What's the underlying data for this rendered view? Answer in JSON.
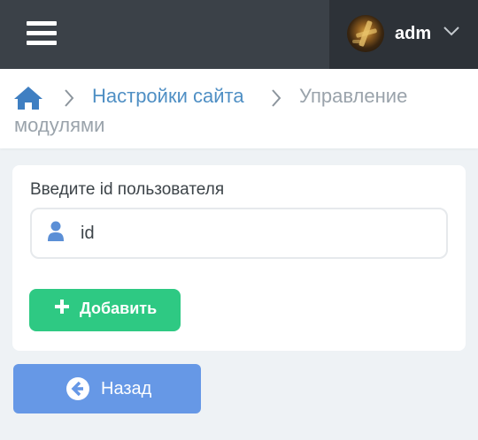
{
  "header": {
    "menu_icon": "hamburger-menu-icon",
    "user": {
      "name": "adm",
      "avatar_icon": "user-avatar",
      "dropdown_icon": "chevron-down-icon"
    }
  },
  "breadcrumb": {
    "home_icon": "home-icon",
    "separator_icon": "chevron-right-icon",
    "items": [
      {
        "label": "Настройки сайта"
      },
      {
        "label": "Управление",
        "label_cont": "модулями"
      }
    ]
  },
  "form": {
    "label": "Введите id пользователя",
    "input": {
      "value": "id",
      "icon": "user-icon"
    },
    "add_button": {
      "label": "Добавить",
      "icon": "plus-icon"
    }
  },
  "back_button": {
    "label": "Назад",
    "icon": "arrow-left-circle-icon"
  },
  "colors": {
    "topbar": "#3b4148",
    "user_area": "#2d3238",
    "link": "#4f8fc4",
    "muted": "#9aa3ab",
    "success": "#2ec983",
    "primary": "#6698e6",
    "background": "#eef2f5"
  }
}
